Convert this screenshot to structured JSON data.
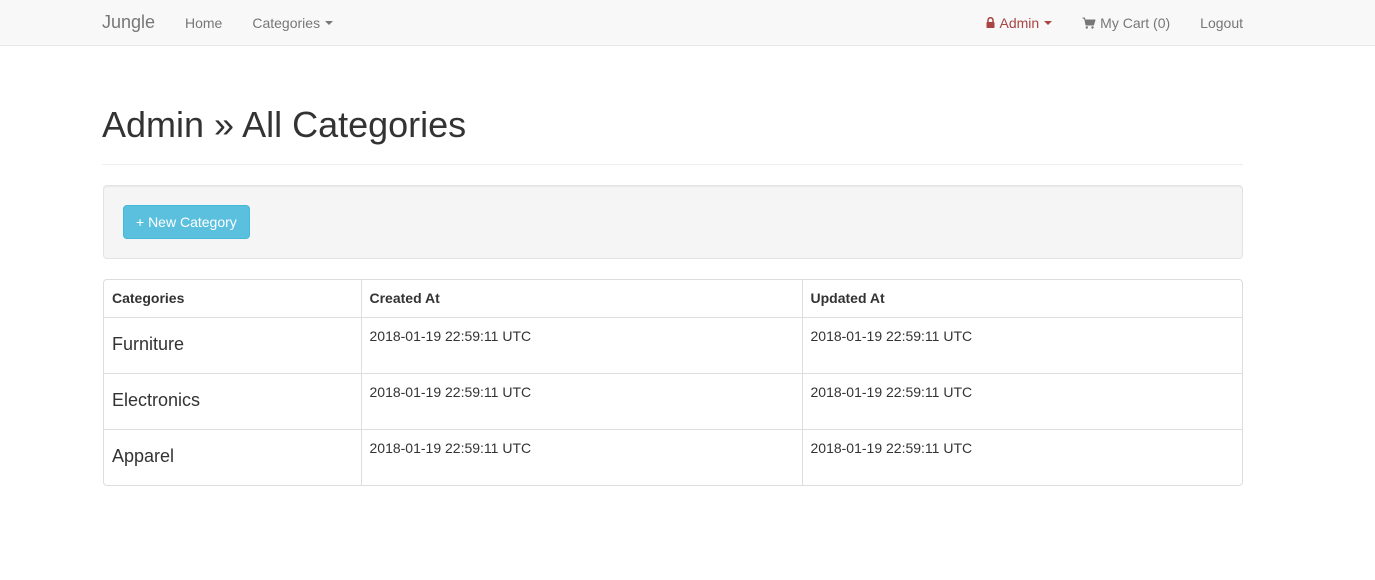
{
  "navbar": {
    "brand": "Jungle",
    "left_items": [
      {
        "label": "Home"
      },
      {
        "label": "Categories"
      }
    ],
    "right_items": {
      "admin": {
        "label": "Admin",
        "icon": "lock-icon",
        "color": "#a94442"
      },
      "cart": {
        "label": "My Cart (0)",
        "icon": "cart-icon"
      },
      "logout": {
        "label": "Logout"
      }
    }
  },
  "page": {
    "title": "Admin » All Categories"
  },
  "actions": {
    "new_category_label": "+ New Category",
    "button_color": "#5bc0de"
  },
  "table": {
    "headers": [
      "Categories",
      "Created At",
      "Updated At"
    ],
    "rows": [
      {
        "name": "Furniture",
        "created_at": "2018-01-19 22:59:11 UTC",
        "updated_at": "2018-01-19 22:59:11 UTC"
      },
      {
        "name": "Electronics",
        "created_at": "2018-01-19 22:59:11 UTC",
        "updated_at": "2018-01-19 22:59:11 UTC"
      },
      {
        "name": "Apparel",
        "created_at": "2018-01-19 22:59:11 UTC",
        "updated_at": "2018-01-19 22:59:11 UTC"
      }
    ]
  }
}
